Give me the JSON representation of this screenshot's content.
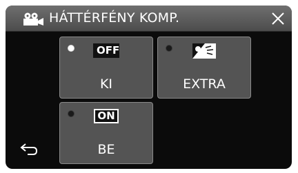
{
  "header": {
    "title": "HÁTTÉRFÉNY KOMP.",
    "mode_icon": "video-camera-icon",
    "close_icon": "close-icon"
  },
  "options": [
    {
      "label": "KI",
      "badge": "OFF",
      "icon": "off-badge-icon",
      "selected": true
    },
    {
      "label": "EXTRA",
      "icon": "backlight-extra-icon",
      "selected": false
    },
    {
      "label": "BE",
      "badge": "ON",
      "icon": "on-badge-icon",
      "selected": false
    }
  ],
  "footer": {
    "back_icon": "back-arrow-icon"
  },
  "colors": {
    "background": "#0b0b0b",
    "header": "#5c5c5c",
    "button": "#545454",
    "text": "#ffffff"
  }
}
